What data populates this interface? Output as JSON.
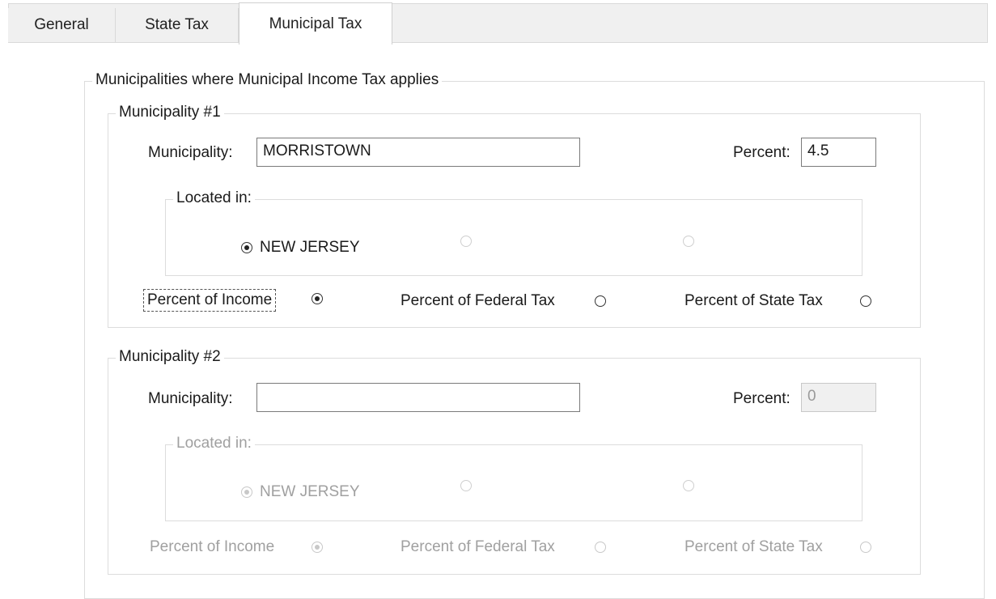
{
  "tabs": [
    {
      "label": "General"
    },
    {
      "label": "State Tax"
    },
    {
      "label": "Municipal Tax",
      "active": true
    }
  ],
  "outer_group": {
    "title": "Municipalities where Municipal Income Tax applies"
  },
  "municipality1": {
    "title": "Municipality #1",
    "municipality_label": "Municipality:",
    "municipality_value": "MORRISTOWN",
    "percent_label": "Percent:",
    "percent_value": "4.5",
    "located_in": {
      "title": "Located in:",
      "options": [
        {
          "label": "NEW JERSEY",
          "checked": true
        },
        {
          "label": "",
          "checked": false
        },
        {
          "label": "",
          "checked": false
        }
      ]
    },
    "basis_options": [
      {
        "label": "Percent of Income",
        "checked": true
      },
      {
        "label": "Percent of Federal Tax",
        "checked": false
      },
      {
        "label": "Percent of State Tax",
        "checked": false
      }
    ]
  },
  "municipality2": {
    "title": "Municipality  #2",
    "municipality_label": "Municipality:",
    "municipality_value": "",
    "percent_label": "Percent:",
    "percent_value": "0",
    "located_in": {
      "title": "Located in:",
      "options": [
        {
          "label": "NEW JERSEY",
          "checked": true
        },
        {
          "label": "",
          "checked": false
        },
        {
          "label": "",
          "checked": false
        }
      ]
    },
    "basis_options": [
      {
        "label": "Percent of Income",
        "checked": true
      },
      {
        "label": "Percent of Federal Tax",
        "checked": false
      },
      {
        "label": "Percent of State Tax",
        "checked": false
      }
    ]
  }
}
